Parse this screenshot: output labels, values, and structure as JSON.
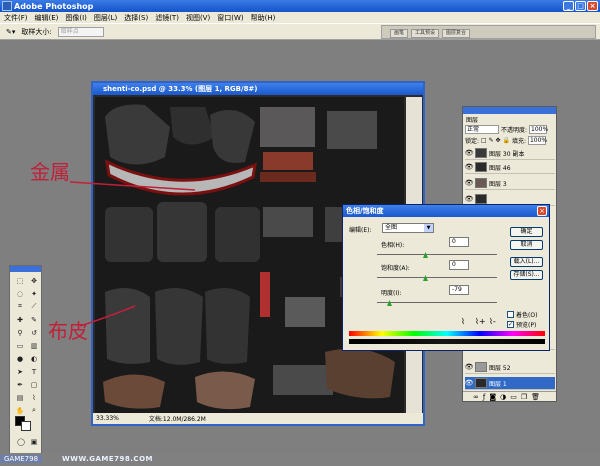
{
  "app": {
    "title": "Adobe Photoshop"
  },
  "menu": [
    "文件(F)",
    "编辑(E)",
    "图像(I)",
    "图层(L)",
    "选择(S)",
    "滤镜(T)",
    "视图(V)",
    "窗口(W)",
    "帮助(H)"
  ],
  "options": {
    "sample_label": "取样大小:",
    "sample_value": "取样点"
  },
  "well": {
    "tabs": [
      "画笔",
      "工具预设",
      "图层复合"
    ]
  },
  "document": {
    "title": "shenti-co.psd @ 33.3% (图层 1, RGB/8#)",
    "zoom": "33.33%",
    "doc_size": "文档:12.0M/286.2M"
  },
  "layers": {
    "tab": "图层",
    "blend_mode": "正常",
    "opacity_label": "不透明度:",
    "opacity": "100%",
    "lock_label": "锁定:",
    "fill_label": "填充:",
    "fill": "100%",
    "rows": [
      {
        "name": "图层 30 副本",
        "thumb": "#3a3a3a"
      },
      {
        "name": "图层 46",
        "thumb": "#2a2a2a"
      },
      {
        "name": "图层 3",
        "thumb": "#6b5a52"
      },
      {
        "name": "图层 52",
        "thumb": "#9a9a9a"
      },
      {
        "name": "图层 1",
        "thumb": "#2a2a2a",
        "selected": true
      }
    ]
  },
  "dialog": {
    "title": "色相/饱和度",
    "edit_label": "编辑(E):",
    "edit_value": "全图",
    "hue_label": "色相(H):",
    "hue": "0",
    "saturation_label": "饱和度(A):",
    "saturation": "0",
    "lightness_label": "明度(I):",
    "lightness": "-79",
    "lightness_fraction": 0.1,
    "buttons": [
      "确定",
      "取消",
      "载入(L)...",
      "存储(S)..."
    ],
    "colorize_label": "着色(O)",
    "colorize": false,
    "preview_label": "预览(P)",
    "preview": true
  },
  "annotations": [
    "金属",
    "布皮"
  ],
  "watermark": "WWW.GAME798.COM",
  "watermark_tab": "GAME798"
}
